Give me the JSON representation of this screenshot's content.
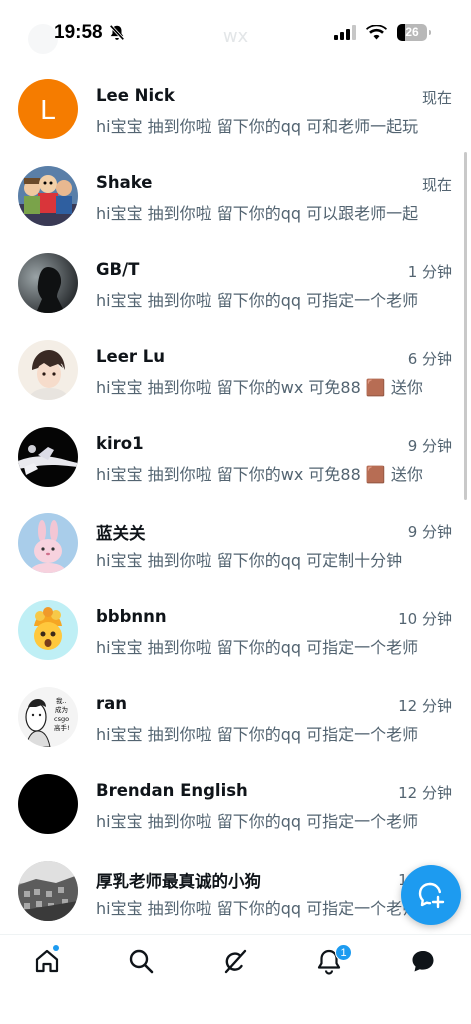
{
  "status_bar": {
    "time": "19:58",
    "battery": "26"
  },
  "header": {
    "ghost_title": "wx"
  },
  "conversations": [
    {
      "name": "Lee Nick",
      "time": "现在",
      "preview": "hi宝宝 抽到你啦 留下你的qq 可和老师一起玩"
    },
    {
      "name": "Shake",
      "time": "现在",
      "preview": "hi宝宝 抽到你啦 留下你的qq 可以跟老师一起"
    },
    {
      "name": "GB/T",
      "time": "1 分钟",
      "preview": "hi宝宝 抽到你啦 留下你的qq 可指定一个老师"
    },
    {
      "name": "Leer Lu",
      "time": "6 分钟",
      "preview": "hi宝宝 抽到你啦 留下你的wx 可免88 🟫 送你"
    },
    {
      "name": "kiro1",
      "time": "9 分钟",
      "preview": "hi宝宝 抽到你啦 留下你的wx 可免88 🟫 送你"
    },
    {
      "name": "蓝关关",
      "time": "9 分钟",
      "preview": "hi宝宝 抽到你啦 留下你的qq 可定制十分钟"
    },
    {
      "name": "bbbnnn",
      "time": "10 分钟",
      "preview": "hi宝宝 抽到你啦 留下你的qq 可指定一个老师"
    },
    {
      "name": "ran",
      "time": "12 分钟",
      "preview": "hi宝宝 抽到你啦 留下你的qq 可指定一个老师"
    },
    {
      "name": "Brendan English",
      "time": "12 分钟",
      "preview": "hi宝宝 抽到你啦 留下你的qq 可指定一个老师"
    },
    {
      "name": "厚乳老师最真诚的小狗",
      "time": "12 分钟",
      "preview": "hi宝宝 抽到你啦 留下你的qq 可指定一个老师"
    }
  ],
  "avatars": {
    "lee_nick_letter": "L",
    "lee_nick_color": "#f57c00",
    "ran_text_1": "我..",
    "ran_text_2": "成为",
    "ran_text_3": "csgo",
    "ran_text_4": "高手!"
  },
  "tabbar": {
    "notification_count": "1",
    "accent": "#1d9bf0"
  },
  "icons": [
    "mute-icon",
    "signal-icon",
    "wifi-icon",
    "battery-icon",
    "home-icon",
    "search-icon",
    "grok-icon",
    "notifications-icon",
    "messages-icon",
    "new-message-icon"
  ]
}
